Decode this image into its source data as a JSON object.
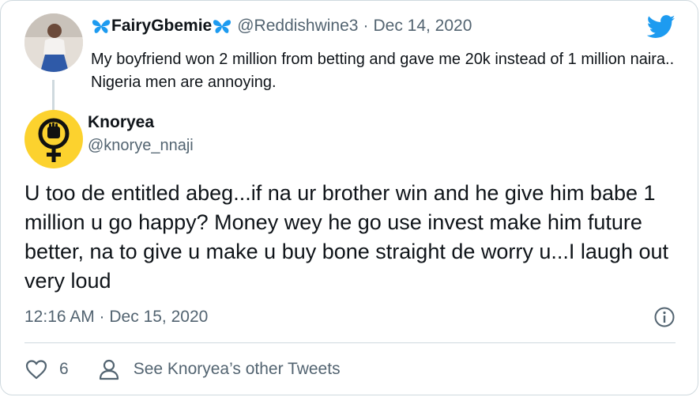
{
  "parent_tweet": {
    "display_name": "FairyGbemie",
    "handle": "@Reddishwine3",
    "separator": "·",
    "date": "Dec 14, 2020",
    "text": "My boyfriend won 2 million from betting and gave me 20k instead of 1 million naira.. Nigeria men are annoying.",
    "name_icons": [
      "butterfly-icon",
      "butterfly-icon"
    ]
  },
  "platform_icon": "twitter-bird-icon",
  "reply_tweet": {
    "display_name": "Knoryea",
    "handle": "@knorye_nnaji",
    "text": "U too de entitled abeg...if na ur brother win and he give him babe 1 million u go happy? Money wey he go use invest make him future better, na to give u make u buy bone straight de worry u...I laugh out very loud",
    "timestamp": "12:16 AM · Dec 15, 2020",
    "avatar_icon": "feminist-fist-icon"
  },
  "actions": {
    "like_count": "6",
    "see_other_label": "See Knoryea’s other Tweets",
    "like_icon": "heart-icon",
    "profile_icon": "person-icon",
    "info_icon": "info-icon"
  },
  "colors": {
    "twitter_blue": "#1d9bf0",
    "text": "#0f1419",
    "muted": "#536471",
    "border": "#cfd9de",
    "avatar_yellow": "#fcd22e"
  }
}
